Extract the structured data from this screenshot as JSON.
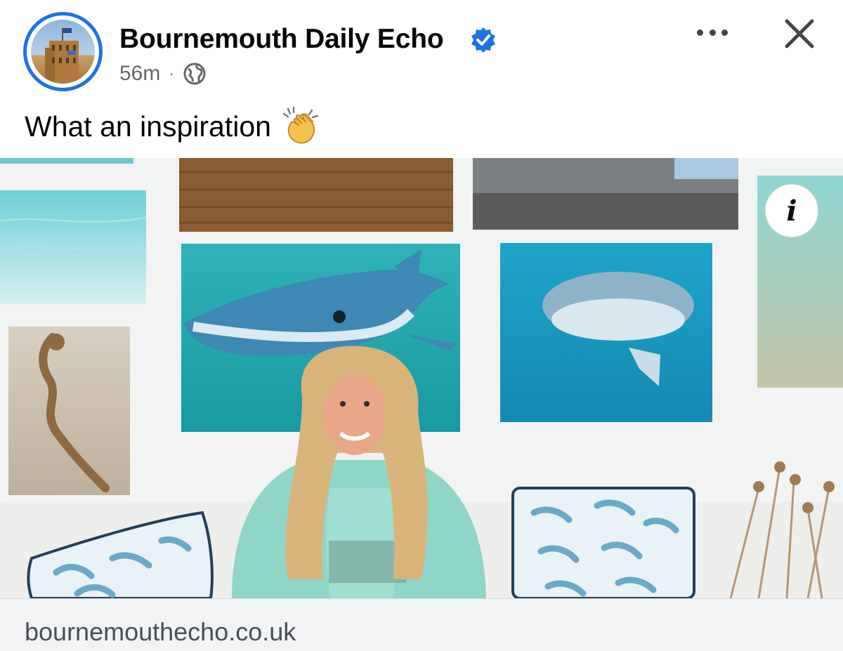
{
  "post": {
    "page_name": "Bournemouth Daily Echo",
    "verified_icon": "verified-badge-icon",
    "timestamp": "56m",
    "separator": "·",
    "audience_icon": "globe-icon",
    "caption": "What an inspiration",
    "caption_emoji": "clapping-hands-icon"
  },
  "actions": {
    "more_icon": "more-dots-icon",
    "close_icon": "close-icon",
    "info_label": "i"
  },
  "link_preview": {
    "domain": "bournemouthecho.co.uk"
  },
  "colors": {
    "accent": "#1b74e4",
    "text_primary": "#050505",
    "text_secondary": "#65676b",
    "link_bar_bg": "#f2f3f5"
  }
}
